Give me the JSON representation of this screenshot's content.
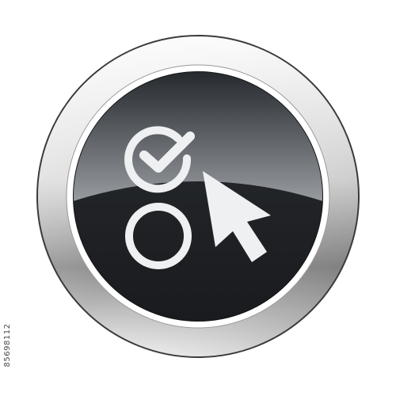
{
  "icon": {
    "name": "checklist-select-cursor-button",
    "glyphs": [
      "check-circle-icon",
      "empty-circle-icon",
      "mouse-cursor-icon"
    ],
    "colors": {
      "background": "#ffffff",
      "bezel_light": "#f2f2f2",
      "bezel_dark": "#5e5e5e",
      "ring": "#ffffff",
      "face_top": "#8c9094",
      "face_bottom": "#1e2124",
      "glyph": "#f0f2f4"
    }
  },
  "side_text": "85698112"
}
